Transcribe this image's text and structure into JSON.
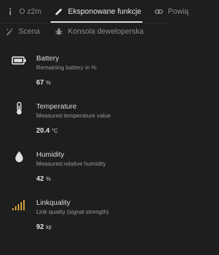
{
  "tabs": {
    "about": {
      "label": "O z2m",
      "icon": "info-icon"
    },
    "exposes": {
      "label": "Eksponowane funkcje",
      "icon": "pencil-icon"
    },
    "bind": {
      "label": "Powią",
      "icon": "link-icon"
    },
    "scene": {
      "label": "Scena",
      "icon": "magic-wand-icon"
    },
    "dev_console": {
      "label": "Konsola deweloperska",
      "icon": "bug-icon"
    }
  },
  "features": [
    {
      "name": "Battery",
      "description": "Remaining battery in %",
      "value": "67",
      "unit": "%",
      "icon": "battery-icon"
    },
    {
      "name": "Temperature",
      "description": "Measured temperature value",
      "value": "20.4",
      "unit": "°C",
      "icon": "thermometer-icon"
    },
    {
      "name": "Humidity",
      "description": "Measured relative humidity",
      "value": "42",
      "unit": "%",
      "icon": "water-drop-icon"
    },
    {
      "name": "Linkquality",
      "description": "Link quality (signal strength)",
      "value": "92",
      "unit": "lqi",
      "icon": "signal-icon"
    }
  ],
  "colors": {
    "background": "#1e1e1e",
    "signal_accent": "#d9a23c"
  }
}
